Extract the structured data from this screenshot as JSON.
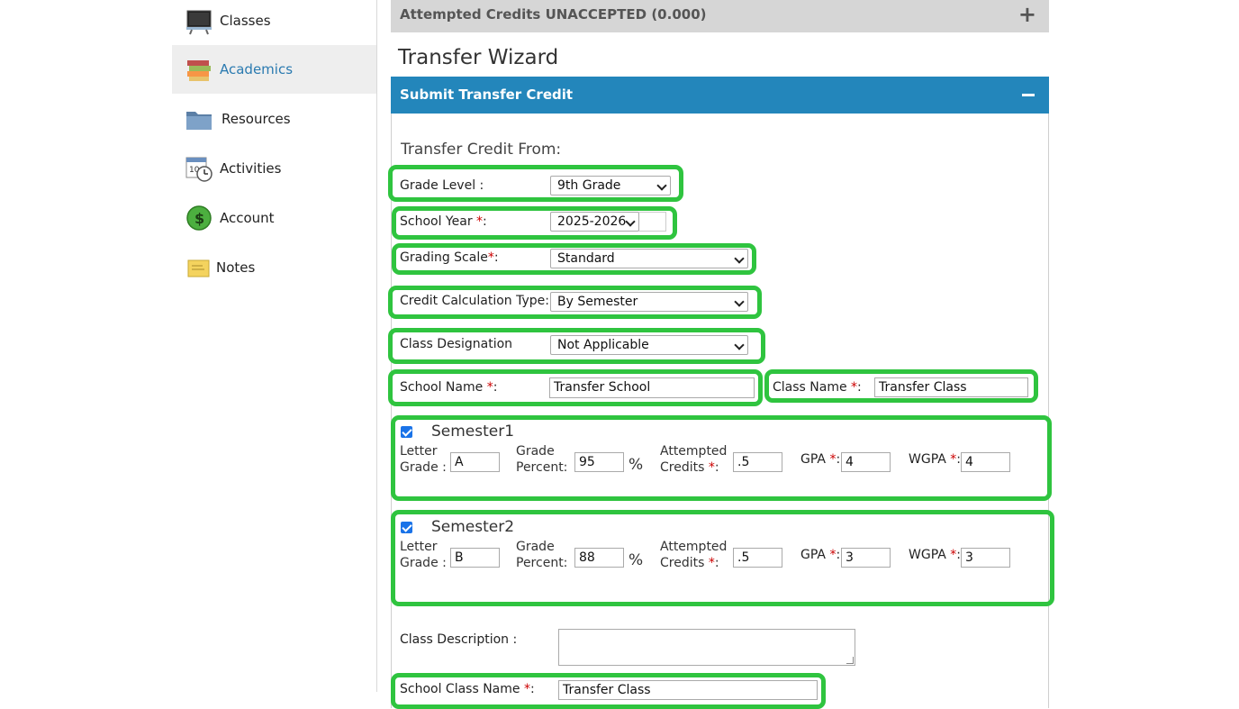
{
  "sidebar": {
    "items": [
      {
        "label": "Classes",
        "icon": "chalkboard-icon",
        "active": false
      },
      {
        "label": "Academics",
        "icon": "books-icon",
        "active": true
      },
      {
        "label": "Resources",
        "icon": "folder-icon",
        "active": false
      },
      {
        "label": "Activities",
        "icon": "calendar-clock-icon",
        "active": false
      },
      {
        "label": "Account",
        "icon": "dollar-coin-icon",
        "active": false
      },
      {
        "label": "Notes",
        "icon": "sticky-note-icon",
        "active": false
      }
    ]
  },
  "accordion": {
    "attempted_unaccepted": "Attempted Credits UNACCEPTED (0.000)"
  },
  "wizard": {
    "title": "Transfer Wizard"
  },
  "panel": {
    "title": "Submit Transfer Credit"
  },
  "form": {
    "section_title": "Transfer Credit From:",
    "grade_level": {
      "label": "Grade Level :",
      "value": "9th Grade"
    },
    "school_year": {
      "label": "School Year ",
      "req": "*",
      ":": ":",
      "value": "2025-2026"
    },
    "grading_scale": {
      "label": "Grading Scale",
      "req": "*",
      "value": "Standard"
    },
    "credit_calc": {
      "label": "Credit Calculation Type:",
      "value": "By Semester"
    },
    "class_designation": {
      "label": "Class Designation",
      "value": "Not Applicable"
    },
    "school_name": {
      "label": "School Name ",
      "req": "*",
      "value": "Transfer School"
    },
    "class_name": {
      "label": "Class Name ",
      "req": "*",
      "value": "Transfer Class"
    },
    "semesters": [
      {
        "title": "Semester1",
        "letter_grade": "A",
        "grade_percent": "95",
        "attempted_credits": ".5",
        "gpa": "4",
        "wgpa": "4"
      },
      {
        "title": "Semester2",
        "letter_grade": "B",
        "grade_percent": "88",
        "attempted_credits": ".5",
        "gpa": "3",
        "wgpa": "3"
      }
    ],
    "labels": {
      "letter_grade_1": "Letter",
      "letter_grade_2": "Grade :",
      "grade_percent_1": "Grade",
      "grade_percent_2": "Percent:",
      "attempted_1": "Attempted",
      "attempted_2": "Credits ",
      "gpa": "GPA ",
      "wgpa": "WGPA ",
      "req": "*",
      "colon": ":",
      "pct": "%"
    },
    "class_description": {
      "label": "Class Description :"
    },
    "school_class_name": {
      "label": "School Class Name ",
      "req": "*",
      "value": "Transfer Class"
    }
  },
  "colors": {
    "accent": "#2386bb",
    "highlight": "#2fc43f",
    "required": "#cc0000"
  }
}
